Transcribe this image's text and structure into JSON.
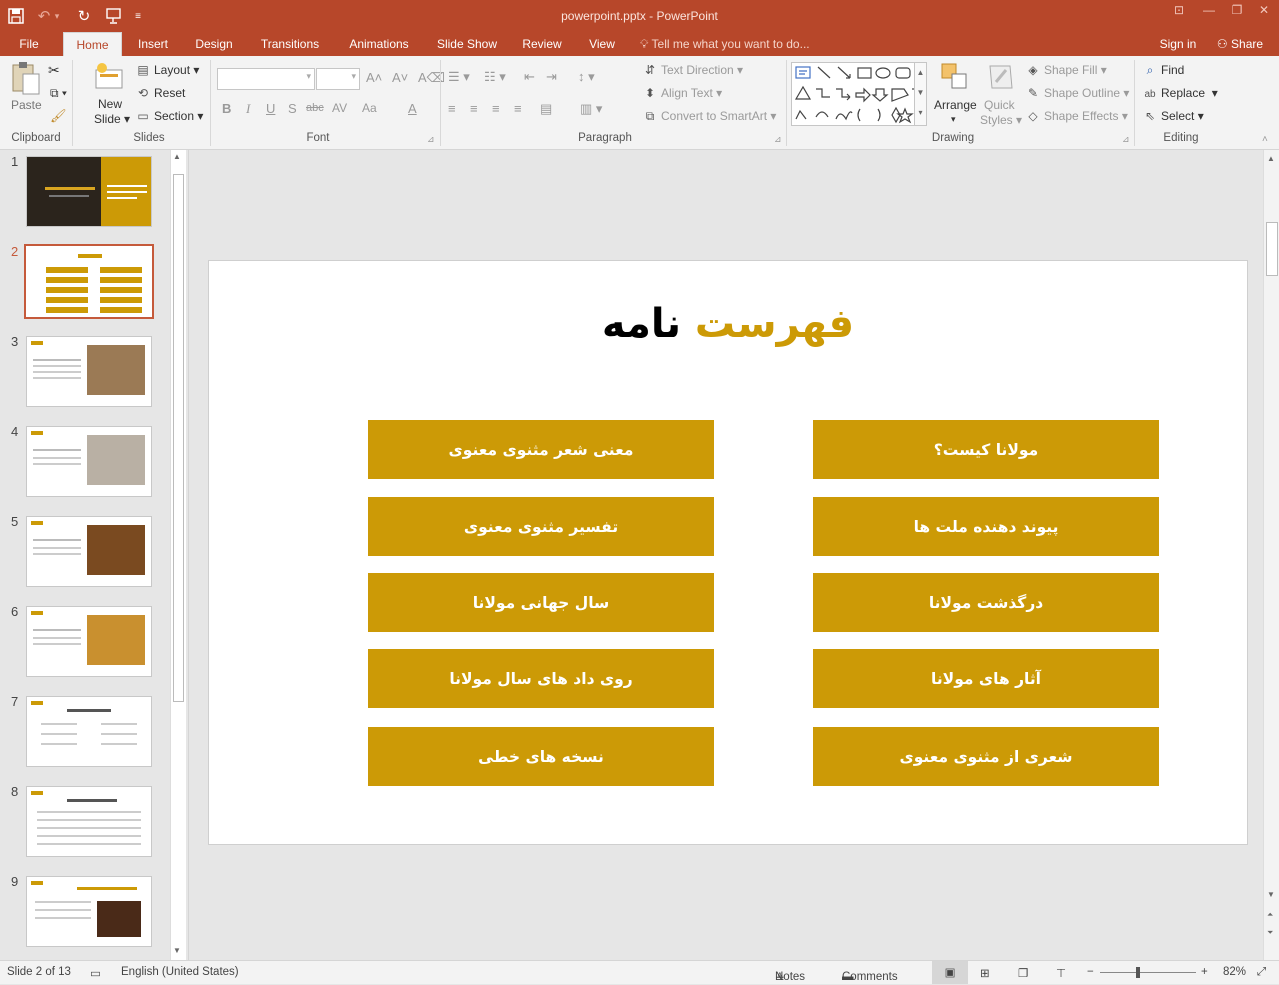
{
  "window": {
    "title": "powerpoint.pptx - PowerPoint"
  },
  "tabs": [
    "File",
    "Home",
    "Insert",
    "Design",
    "Transitions",
    "Animations",
    "Slide Show",
    "Review",
    "View"
  ],
  "tell_me": "Tell me what you want to do...",
  "account": {
    "sign_in": "Sign in",
    "share": "Share"
  },
  "ribbon": {
    "clipboard": {
      "paste": "Paste",
      "label": "Clipboard"
    },
    "slides": {
      "new_slide_1": "New",
      "new_slide_2": "Slide",
      "layout": "Layout",
      "reset": "Reset",
      "section": "Section",
      "label": "Slides"
    },
    "font": {
      "label": "Font",
      "bold": "B",
      "italic": "I",
      "underline": "U",
      "shadow": "S",
      "strike": "abc",
      "spacing": "AV",
      "case": "Aa",
      "color": "A"
    },
    "paragraph": {
      "text_direction": "Text Direction",
      "align_text": "Align Text",
      "convert_smartart": "Convert to SmartArt",
      "label": "Paragraph"
    },
    "drawing": {
      "arrange": "Arrange",
      "quick_styles_1": "Quick",
      "quick_styles_2": "Styles",
      "shape_fill": "Shape Fill",
      "shape_outline": "Shape Outline",
      "shape_effects": "Shape Effects",
      "label": "Drawing"
    },
    "editing": {
      "find": "Find",
      "replace": "Replace",
      "select": "Select",
      "label": "Editing"
    }
  },
  "thumbnails": [
    "1",
    "2",
    "3",
    "4",
    "5",
    "6",
    "7",
    "8",
    "9"
  ],
  "slide": {
    "title_gold": "فهرست",
    "title_black": "نامه",
    "right_column": [
      "مولانا کیست؟",
      "پیوند دهنده ملت ها",
      "درگذشت مولانا",
      "آثار های مولانا",
      "شعری از مثنوی معنوی"
    ],
    "left_column": [
      "معنی شعر مثنوی معنوی",
      "تفسیر مثنوی معنوی",
      "سال جهانی مولانا",
      "روی داد های سال مولانا",
      "نسخه های خطی"
    ]
  },
  "colors": {
    "accent": "#b7472a",
    "gold": "#cc9a06"
  },
  "status": {
    "slide_of": "Slide 2 of 13",
    "language": "English (United States)",
    "notes": "Notes",
    "comments": "Comments",
    "zoom": "82%"
  }
}
